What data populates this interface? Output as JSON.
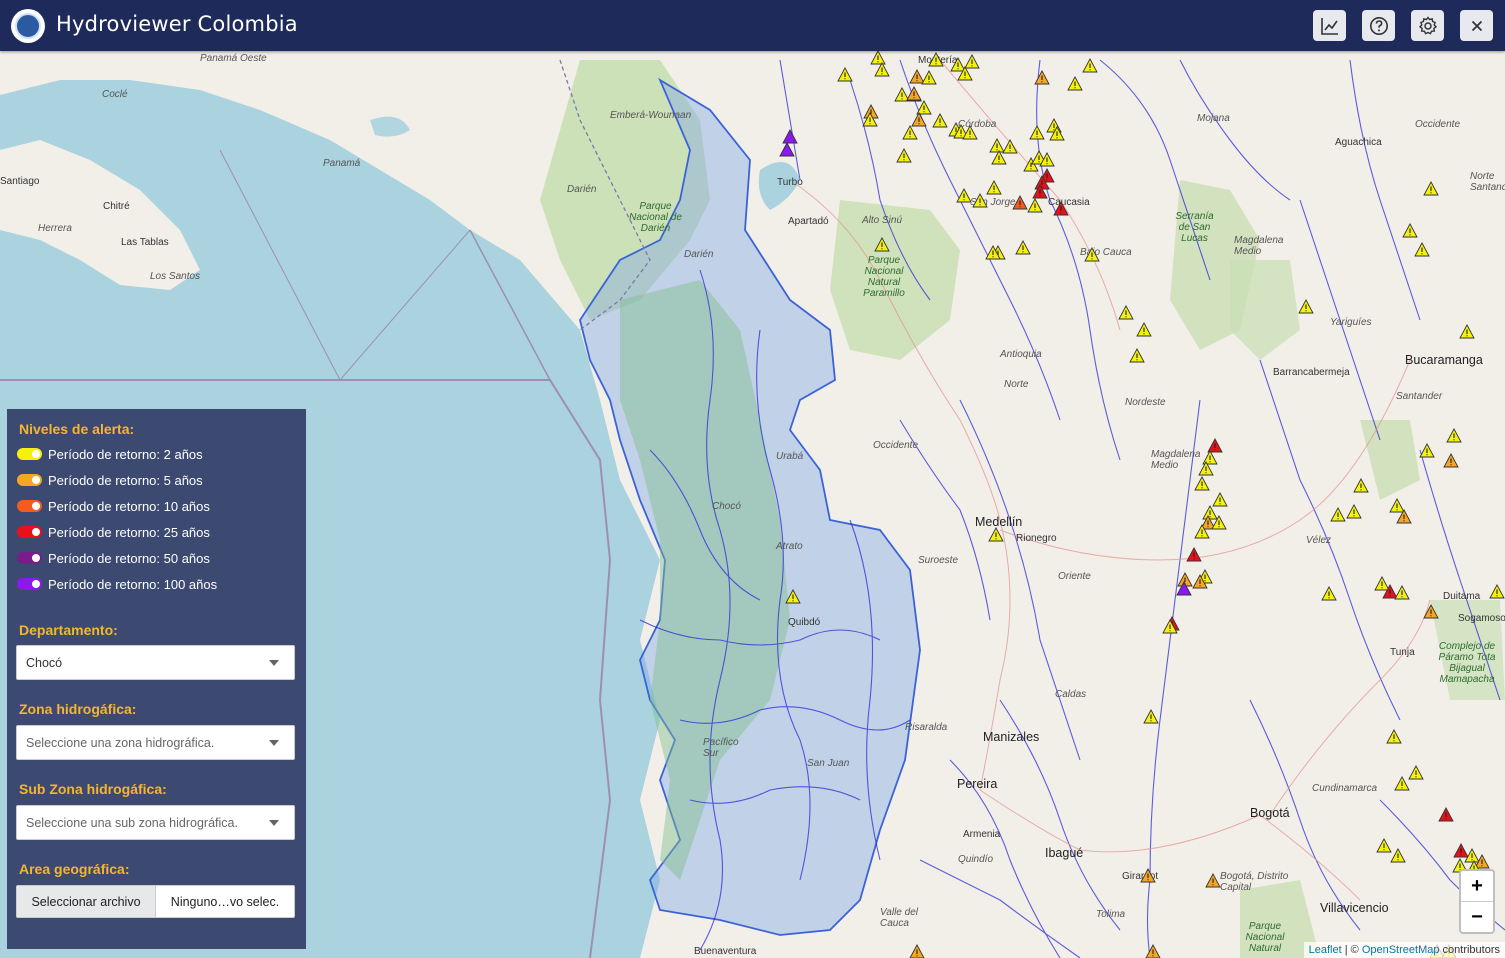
{
  "header": {
    "title": "Hydroviewer Colombia",
    "buttons": [
      {
        "name": "chart-icon"
      },
      {
        "name": "help-icon"
      },
      {
        "name": "settings-icon"
      },
      {
        "name": "close-icon"
      }
    ]
  },
  "map": {
    "labels": {
      "panama_oeste": "Panamá Oeste",
      "cocle": "Coclé",
      "embera": "Emberá-Wounaan",
      "panama": "Panamá",
      "santiago": "Santiago",
      "chitre": "Chitré",
      "darien": "Darién",
      "herrera": "Herrera",
      "las_tablas": "Las Tablas",
      "los_santos": "Los Santos",
      "parque_darien": "Parque Nacional de Darién",
      "turbo": "Turbo",
      "apartado": "Apartadó",
      "darien_co": "Darién",
      "alto_sinu": "Alto Sinú",
      "paramillo": "Parque Nacional Natural Paramillo",
      "monteria": "Montería",
      "cordoba": "Córdoba",
      "san_jorge": "San Jorge",
      "caucasia": "Caucasia",
      "bajo_cauca": "Bajo Cauca",
      "mojana": "Mojana",
      "aguachica": "Aguachica",
      "occidente_n": "Occidente",
      "norte_santander": "Norte Santander",
      "serrania_san_lucas": "Serranía de San Lucas",
      "magdalena_medio": "Magdalena Medio",
      "yariguies": "Yariguíes",
      "bucaramanga": "Bucaramanga",
      "barrancabermeja": "Barrancabermeja",
      "santander": "Santander",
      "antioquia": "Antioquia",
      "norte": "Norte",
      "nordeste": "Nordeste",
      "occidente": "Occidente",
      "magdalena_medio2": "Magdalena Medio",
      "uraba": "Urabá",
      "choco": "Chocó",
      "atrato": "Atrato",
      "medellin": "Medellín",
      "rionegro": "Rionegro",
      "suroeste": "Suroeste",
      "oriente": "Oriente",
      "velez": "Vélez",
      "duitama": "Duitama",
      "sogamoso": "Sogamoso",
      "tunja": "Tunja",
      "complejo": "Complejo de Páramo Tota Bijagual Mamapacha",
      "quibdo": "Quibdó",
      "caldas": "Caldas",
      "risaralda": "Risaralda",
      "manizales": "Manizales",
      "pereira": "Pereira",
      "pacifico_sur": "Pacífico Sur",
      "san_juan": "San Juan",
      "armenia": "Armenia",
      "quindio": "Quindío",
      "ibague": "Ibagué",
      "girardot": "Girardot",
      "bogota": "Bogotá",
      "bogota_dc": "Bogotá, Distrito Capital",
      "cundinamarca": "Cundinamarca",
      "villavicencio": "Villavicencio",
      "valle_cauca": "Valle del Cauca",
      "tolima": "Tolima",
      "buenaventura": "Buenaventura",
      "parque_sur": "Parque Nacional Natural"
    },
    "zoom": {
      "in": "+",
      "out": "−"
    },
    "attribution": {
      "leaflet": "Leaflet",
      "sep": " | © ",
      "osm": "OpenStreetMap",
      "contrib": " contributors"
    }
  },
  "panel": {
    "alert_title": "Niveles de alerta:",
    "legend": [
      {
        "label": "Período de retorno: 2 años",
        "color": "#f4f10a"
      },
      {
        "label": "Período de retorno: 5 años",
        "color": "#f5a623"
      },
      {
        "label": "Período de retorno: 10 años",
        "color": "#f45c1f"
      },
      {
        "label": "Período de retorno: 25 años",
        "color": "#e8101a"
      },
      {
        "label": "Período de retorno: 50 años",
        "color": "#7a1d8a"
      },
      {
        "label": "Período de retorno: 100 años",
        "color": "#8a18f0"
      }
    ],
    "departamento_title": "Departamento:",
    "departamento_value": "Chocó",
    "zona_title": "Zona hidrogáfica:",
    "zona_placeholder": "Seleccione una zona hidrográfica.",
    "subzona_title": "Sub Zona hidrogáfica:",
    "subzona_placeholder": "Seleccione una sub zona hidrográfica.",
    "area_title": "Area geográfica:",
    "file_button": "Seleccionar archivo",
    "file_name": "Ninguno…vo selec."
  },
  "colors": {
    "header_bg": "#1e2a5a",
    "panel_bg": "#3c4a72",
    "panel_title": "#f5b62b",
    "sea": "#aad3df",
    "land": "#f2efe9",
    "river": "#2b2bd8",
    "selected_region": "#7fa8e6"
  }
}
